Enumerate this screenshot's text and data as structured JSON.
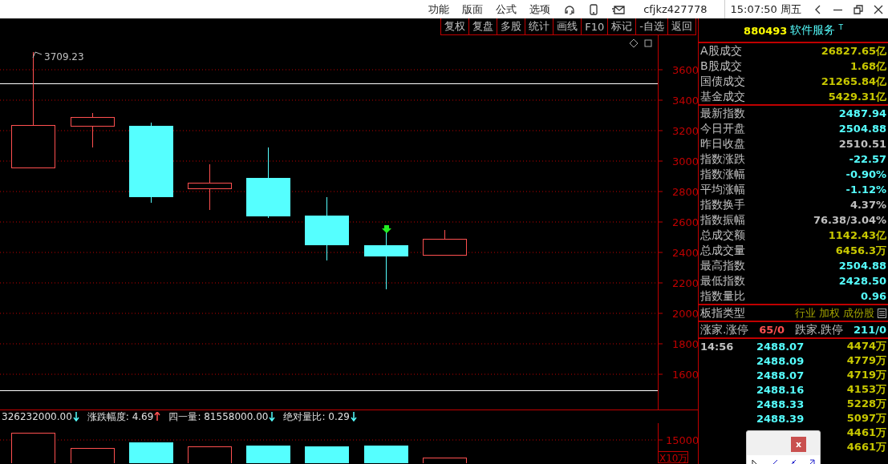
{
  "menu": [
    "功能",
    "版面",
    "公式",
    "选项"
  ],
  "user": "cfjkz427778",
  "clock": "15:07:50 周五",
  "toolbar": [
    "复权",
    "复盘",
    "多股",
    "统计",
    "画线",
    "F10",
    "标记",
    "-自选",
    "返回"
  ],
  "chart": {
    "peak_label": "3709.23",
    "y_ticks": [
      "3600",
      "3400",
      "3200",
      "3000",
      "2800",
      "2600",
      "2400",
      "2200",
      "2000",
      "1800",
      "1600"
    ]
  },
  "indicator_bar": [
    {
      "text": "326232000.00",
      "rising": false
    },
    {
      "text": "涨跌幅度: 4.69",
      "rising": true
    },
    {
      "text": "四一量: 81558000.00",
      "rising": false
    },
    {
      "text": "绝对量比: 0.29",
      "rising": false
    }
  ],
  "volume": {
    "y_tick": "15000",
    "unit": "X10万"
  },
  "quote": {
    "code": "880493",
    "name": "软件服务",
    "flag": "T"
  },
  "stats": [
    {
      "rows": [
        {
          "label": "A股成交",
          "value": "26827.65亿",
          "color": "#c8c800"
        },
        {
          "label": "B股成交",
          "value": "1.68亿",
          "color": "#c8c800"
        },
        {
          "label": "国债成交",
          "value": "21265.84亿",
          "color": "#c8c800"
        },
        {
          "label": "基金成交",
          "value": "5429.31亿",
          "color": "#c8c800"
        }
      ]
    },
    {
      "rows": [
        {
          "label": "最新指数",
          "value": "2487.94",
          "color": "#55ffff"
        },
        {
          "label": "今日开盘",
          "value": "2504.88",
          "color": "#55ffff"
        },
        {
          "label": "昨日收盘",
          "value": "2510.51",
          "color": "#c0c0c0"
        },
        {
          "label": "指数涨跌",
          "value": "-22.57",
          "color": "#55ffff"
        },
        {
          "label": "指数涨幅",
          "value": "-0.90%",
          "color": "#55ffff"
        },
        {
          "label": "平均涨幅",
          "value": "-1.12%",
          "color": "#55ffff"
        },
        {
          "label": "指数换手",
          "value": "4.37%",
          "color": "#c0c0c0"
        },
        {
          "label": "指数振幅",
          "value": "76.38/3.04%",
          "color": "#c0c0c0"
        },
        {
          "label": "总成交额",
          "value": "1142.43亿",
          "color": "#c8c800"
        },
        {
          "label": "总成交量",
          "value": "6456.3万",
          "color": "#c8c800"
        },
        {
          "label": "最高指数",
          "value": "2504.88",
          "color": "#55ffff"
        },
        {
          "label": "最低指数",
          "value": "2428.50",
          "color": "#55ffff"
        },
        {
          "label": "指数量比",
          "value": "0.96",
          "color": "#55ffff"
        }
      ]
    }
  ],
  "board_type": {
    "label": "板指类型",
    "tags": [
      "行业",
      "加权",
      "成份股"
    ]
  },
  "breadth": [
    {
      "label": "涨家.涨停",
      "value": "65/0",
      "color": "#ff5050"
    },
    {
      "label": "跌家.跌停",
      "value": "211/0",
      "color": "#55ffff"
    }
  ],
  "ticks": [
    {
      "time": "14:56",
      "price": "2488.07",
      "volume": "4474万"
    },
    {
      "price": "2488.09",
      "volume": "4779万"
    },
    {
      "price": "2488.07",
      "volume": "4719万"
    },
    {
      "price": "2488.16",
      "volume": "4153万"
    },
    {
      "price": "2488.33",
      "volume": "5228万"
    },
    {
      "price": "2488.39",
      "volume": "5097万"
    },
    {
      "volume": "4461万"
    },
    {
      "volume": "4661万"
    }
  ],
  "tool_dialog": {
    "close": "x"
  }
}
